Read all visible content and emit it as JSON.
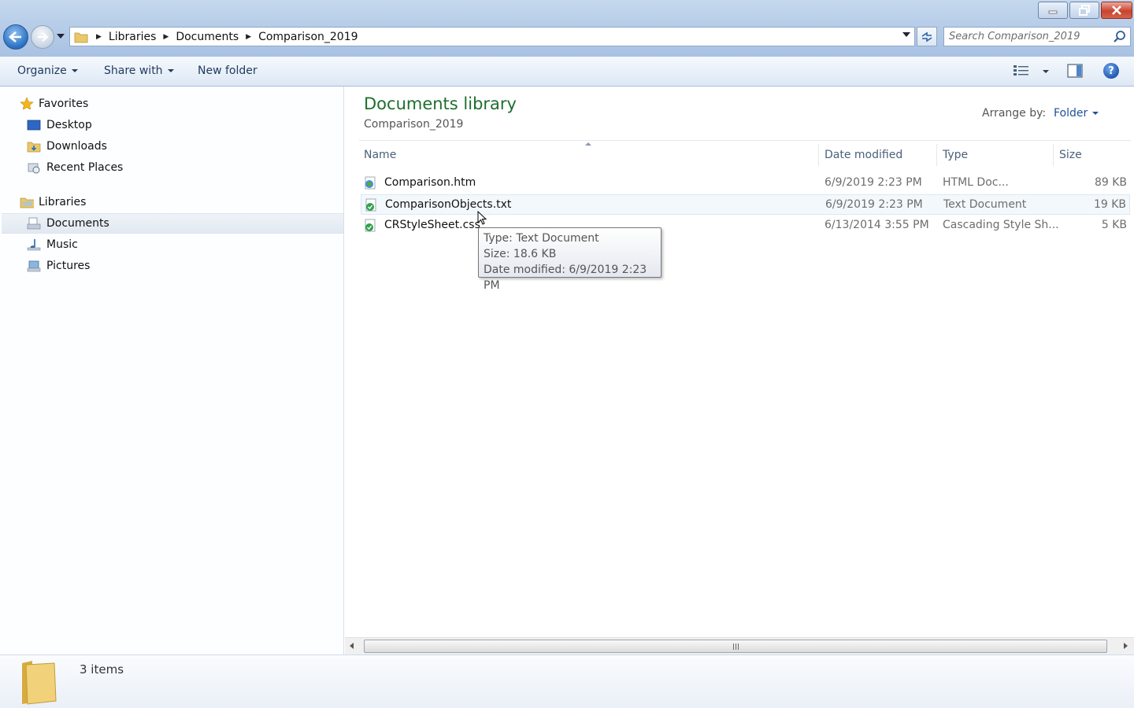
{
  "window": {
    "minimize_icon": "minimize-icon",
    "maximize_icon": "restore-icon",
    "close_icon": "close-icon"
  },
  "address": {
    "breadcrumbs": [
      "Libraries",
      "Documents",
      "Comparison_2019"
    ],
    "search_placeholder": "Search Comparison_2019"
  },
  "toolbar": {
    "organize": "Organize",
    "share_with": "Share with",
    "new_folder": "New folder",
    "help": "?"
  },
  "nav": {
    "favorites": "Favorites",
    "desktop": "Desktop",
    "downloads": "Downloads",
    "recent_places": "Recent Places",
    "libraries": "Libraries",
    "documents": "Documents",
    "music": "Music",
    "pictures": "Pictures",
    "selected": "Documents"
  },
  "content": {
    "library_title": "Documents library",
    "library_subtitle": "Comparison_2019",
    "arrange_by_label": "Arrange by:",
    "arrange_by_value": "Folder",
    "columns": {
      "name": "Name",
      "date_modified": "Date modified",
      "type": "Type",
      "size": "Size"
    },
    "files": [
      {
        "name": "Comparison.htm",
        "date": "6/9/2019 2:23 PM",
        "type": "HTML Doc...",
        "size": "89 KB",
        "icon": "html-file-icon"
      },
      {
        "name": "ComparisonObjects.txt",
        "date": "6/9/2019 2:23 PM",
        "type": "Text Document",
        "size": "19 KB",
        "icon": "text-file-icon"
      },
      {
        "name": "CRStyleSheet.css",
        "date": "6/13/2014 3:55 PM",
        "type": "Cascading Style Sh...",
        "size": "5 KB",
        "icon": "css-file-icon"
      }
    ]
  },
  "tooltip": {
    "type_line": "Type: Text Document",
    "size_line": "Size: 18.6 KB",
    "date_line": "Date modified: 6/9/2019 2:23 PM"
  },
  "status": {
    "item_count": "3 items"
  },
  "colors": {
    "library_title": "#1e6e2e",
    "link_blue": "#1e4f9c",
    "titlebar": "#b7cde8"
  }
}
